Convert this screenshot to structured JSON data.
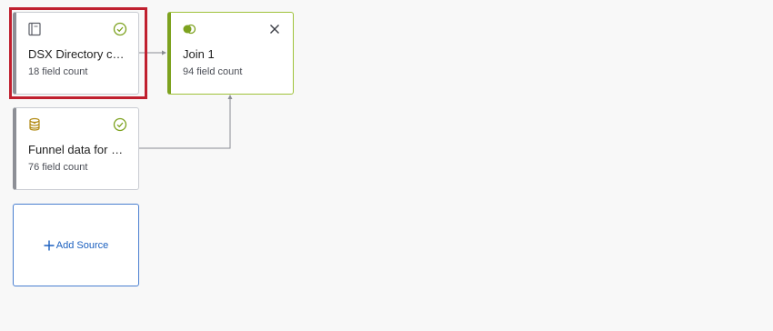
{
  "sources": [
    {
      "title": "DSX Directory contacts",
      "field_count": "18 field count",
      "icon": "directory-book-icon",
      "status": "check-circle-icon",
      "selected": true
    },
    {
      "title": "Funnel data for DSX ...",
      "field_count": "76 field count",
      "icon": "database-stack-icon",
      "status": "check-circle-icon",
      "selected": false
    }
  ],
  "join": {
    "title": "Join 1",
    "field_count": "94 field count",
    "icon": "join-circles-icon",
    "close_icon": "close-icon"
  },
  "add_source": {
    "label": "Add Source",
    "icon": "plus-icon"
  },
  "colors": {
    "canvas_bg": "#f8f8f8",
    "success_green": "#7da21f",
    "selection_red": "#c0202f",
    "link_blue": "#1a5fbf",
    "source_bar_gray": "#8d8f96",
    "database_gold": "#b28a14"
  }
}
